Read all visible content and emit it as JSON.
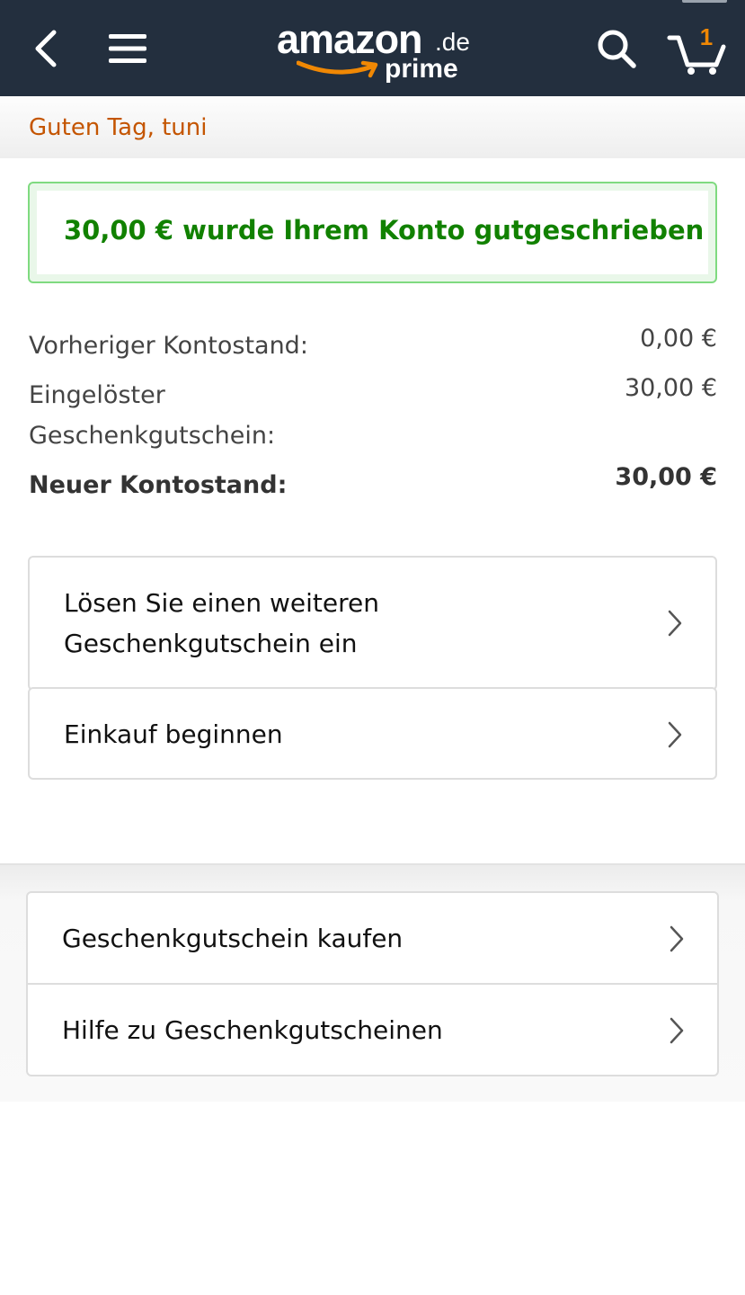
{
  "header": {
    "logo_word": "amazon",
    "logo_tld": ".de",
    "logo_sub": "prime",
    "cart_count": "1",
    "brand_color": "#232f3e",
    "accent_color": "#f08804",
    "icons": [
      "back-icon",
      "menu-icon",
      "search-icon",
      "cart-icon"
    ]
  },
  "greeting": "Guten Tag, tuni",
  "alert": {
    "message": "30,00 € wurde Ihrem Konto gutgeschrieben",
    "color": "#118100"
  },
  "balance": {
    "previous_label": "Vorheriger Kontostand:",
    "previous_value": "0,00 €",
    "redeemed_label_line1": "Eingelöster",
    "redeemed_label_line2": "Geschenkgutschein:",
    "redeemed_value": "30,00 €",
    "new_label": "Neuer Kontostand:",
    "new_value": "30,00 €"
  },
  "actions": {
    "redeem_another_line1": "Lösen Sie einen weiteren",
    "redeem_another_line2": "Geschenkgutschein ein",
    "start_shopping": "Einkauf beginnen"
  },
  "links": {
    "buy_gift_card": "Geschenkgutschein kaufen",
    "gift_card_help": "Hilfe zu Geschenkgutscheinen"
  }
}
